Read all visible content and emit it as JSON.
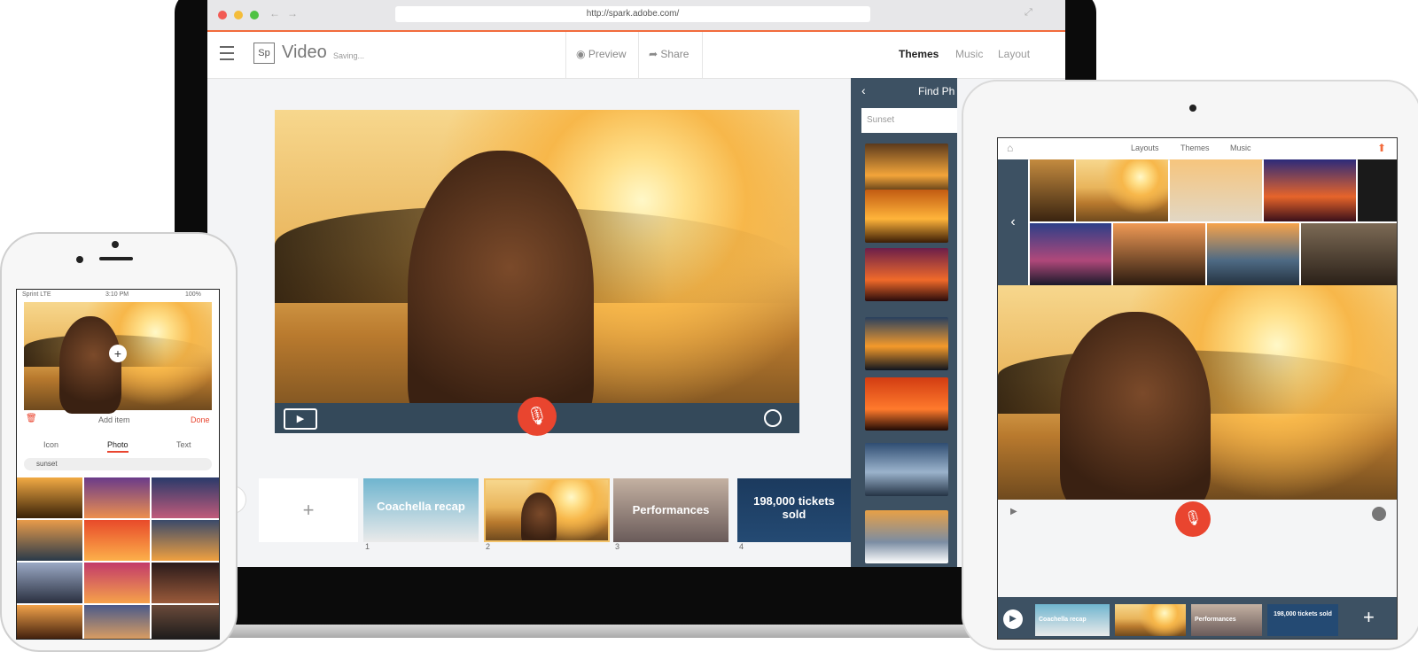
{
  "laptop": {
    "url": "http://spark.adobe.com/",
    "logo": "Sp",
    "app_title": "Video",
    "save_status": "Saving...",
    "preview_label": "Preview",
    "share_label": "Share",
    "tabs": [
      "Themes",
      "Music",
      "Layout"
    ],
    "active_tab": "Themes",
    "find_panel_title": "Find Ph",
    "search_value": "Sunset",
    "film": [
      {
        "label": "",
        "num": ""
      },
      {
        "label": "Coachella recap",
        "num": "1"
      },
      {
        "label": "",
        "num": "2"
      },
      {
        "label": "Performances",
        "num": "3"
      },
      {
        "label": "198,000 tickets sold",
        "num": "4"
      }
    ]
  },
  "ipad": {
    "tabs": [
      "Layouts",
      "Themes",
      "Music"
    ],
    "film": [
      {
        "label": "Coachella recap"
      },
      {
        "label": ""
      },
      {
        "label": "Performances"
      },
      {
        "label": "198,000 tickets sold"
      }
    ]
  },
  "phone": {
    "carrier": "Sprint LTE",
    "time": "3:10 PM",
    "battery": "100%",
    "trash": "🗑",
    "add_item": "Add item",
    "done": "Done",
    "tabs": [
      "Icon",
      "Photo",
      "Text"
    ],
    "active_tab": "Photo",
    "search_value": "sunset"
  },
  "colors": {
    "accent": "#f26b3d",
    "mic": "#e9452f",
    "panel": "#3d5163"
  }
}
